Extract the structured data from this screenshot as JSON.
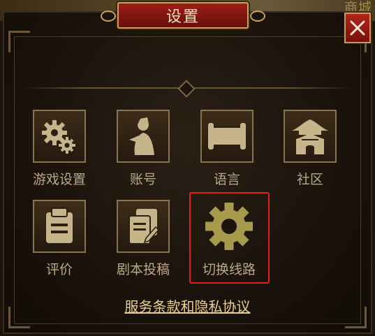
{
  "background": {
    "shop_label": "商城"
  },
  "dialog": {
    "title": "设置",
    "close_label": "X"
  },
  "settings_items": [
    {
      "label": "游戏设置",
      "icon": "gears-icon"
    },
    {
      "label": "账号",
      "icon": "character-icon"
    },
    {
      "label": "语言",
      "icon": "scroll-icon"
    },
    {
      "label": "社区",
      "icon": "pagoda-icon"
    },
    {
      "label": "评价",
      "icon": "clipboard-icon"
    },
    {
      "label": "剧本投稿",
      "icon": "document-submit-icon"
    },
    {
      "label": "切换线路",
      "icon": "gear-icon"
    }
  ],
  "footer": {
    "terms_link": "服务条款和隐私协议"
  },
  "colors": {
    "accent_gold": "#c8a25a",
    "title_red": "#9b1f17",
    "highlight_red": "#e0201c"
  }
}
